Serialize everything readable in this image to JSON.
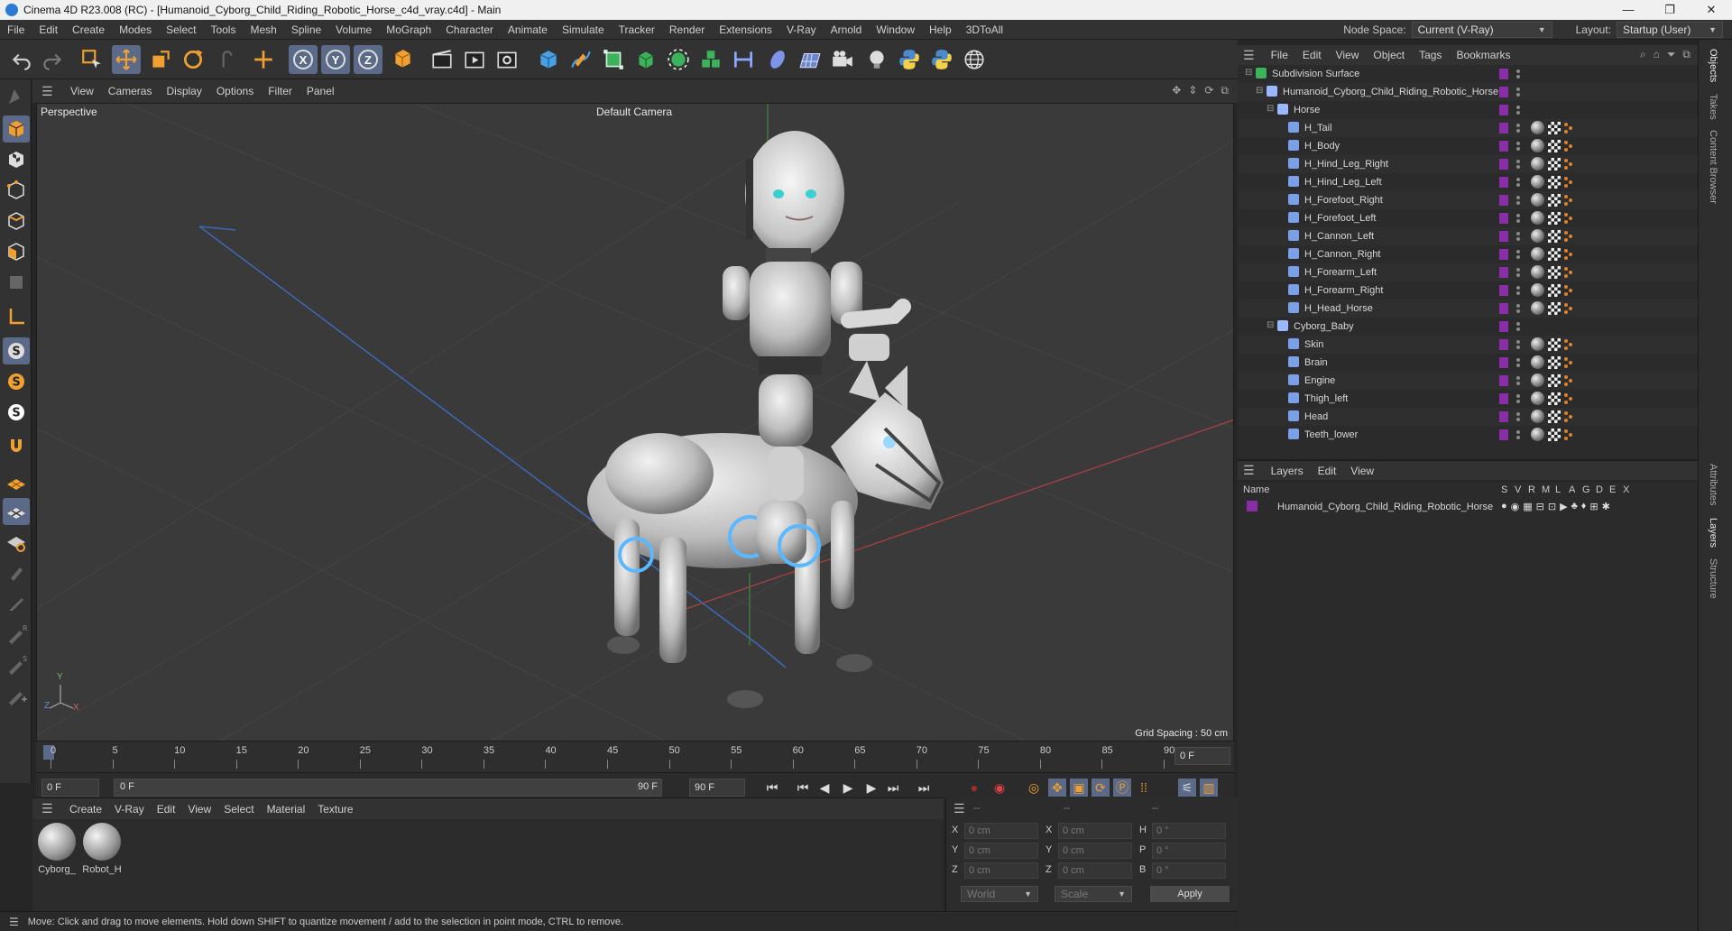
{
  "window": {
    "title": "Cinema 4D R23.008 (RC) - [Humanoid_Cyborg_Child_Riding_Robotic_Horse_c4d_vray.c4d] - Main",
    "controls": [
      "—",
      "❐",
      "✕"
    ]
  },
  "menubar": {
    "items": [
      "File",
      "Edit",
      "Create",
      "Modes",
      "Select",
      "Tools",
      "Mesh",
      "Spline",
      "Volume",
      "MoGraph",
      "Character",
      "Animate",
      "Simulate",
      "Tracker",
      "Render",
      "Extensions",
      "V-Ray",
      "Arnold",
      "Window",
      "Help",
      "3DToAll"
    ],
    "node_space_label": "Node Space:",
    "node_space_value": "Current (V-Ray)",
    "layout_label": "Layout:",
    "layout_value": "Startup (User)"
  },
  "toolbar": {
    "axis_labels": [
      "X",
      "Y",
      "Z"
    ]
  },
  "viewport": {
    "menu": [
      "View",
      "Cameras",
      "Display",
      "Options",
      "Filter",
      "Panel"
    ],
    "view_name": "Perspective",
    "camera": "Default Camera",
    "grid_spacing": "Grid Spacing : 50 cm",
    "axis_x": "X",
    "axis_y": "Y",
    "axis_z": "Z"
  },
  "timeline": {
    "ticks": [
      "0",
      "5",
      "10",
      "15",
      "20",
      "25",
      "30",
      "35",
      "40",
      "45",
      "50",
      "55",
      "60",
      "65",
      "70",
      "75",
      "80",
      "85",
      "90"
    ],
    "current_frame": "0 F",
    "start_field": "0 F",
    "range_start": "0 F",
    "range_end": "90 F",
    "end_field": "90 F"
  },
  "materials": {
    "menu": [
      "Create",
      "V-Ray",
      "Edit",
      "View",
      "Select",
      "Material",
      "Texture"
    ],
    "items": [
      "Cyborg_",
      "Robot_H"
    ]
  },
  "coords": {
    "headers": [
      "--",
      "--",
      "--"
    ],
    "rows": [
      {
        "a": "X",
        "av": "0 cm",
        "b": "X",
        "bv": "0 cm",
        "c": "H",
        "cv": "0 °"
      },
      {
        "a": "Y",
        "av": "0 cm",
        "b": "Y",
        "bv": "0 cm",
        "c": "P",
        "cv": "0 °"
      },
      {
        "a": "Z",
        "av": "0 cm",
        "b": "Z",
        "bv": "0 cm",
        "c": "B",
        "cv": "0 °"
      }
    ],
    "world": "World",
    "scale": "Scale",
    "apply": "Apply"
  },
  "status": "Move: Click and drag to move elements. Hold down SHIFT to quantize movement / add to the selection in point mode, CTRL to remove.",
  "objects": {
    "menu": [
      "File",
      "Edit",
      "View",
      "Object",
      "Tags",
      "Bookmarks"
    ],
    "rows": [
      {
        "name": "Subdivision Surface",
        "level": 0,
        "type": "subdiv"
      },
      {
        "name": "Humanoid_Cyborg_Child_Riding_Robotic_Horse",
        "level": 1,
        "type": "null"
      },
      {
        "name": "Horse",
        "level": 2,
        "type": "null"
      },
      {
        "name": "H_Tail",
        "level": 3,
        "type": "bone"
      },
      {
        "name": "H_Body",
        "level": 3,
        "type": "bone"
      },
      {
        "name": "H_Hind_Leg_Right",
        "level": 3,
        "type": "bone"
      },
      {
        "name": "H_Hind_Leg_Left",
        "level": 3,
        "type": "bone"
      },
      {
        "name": "H_Forefoot_Right",
        "level": 3,
        "type": "bone"
      },
      {
        "name": "H_Forefoot_Left",
        "level": 3,
        "type": "bone"
      },
      {
        "name": "H_Cannon_Left",
        "level": 3,
        "type": "bone"
      },
      {
        "name": "H_Cannon_Right",
        "level": 3,
        "type": "bone"
      },
      {
        "name": "H_Forearm_Left",
        "level": 3,
        "type": "bone"
      },
      {
        "name": "H_Forearm_Right",
        "level": 3,
        "type": "bone"
      },
      {
        "name": "H_Head_Horse",
        "level": 3,
        "type": "bone"
      },
      {
        "name": "Cyborg_Baby",
        "level": 2,
        "type": "null"
      },
      {
        "name": "Skin",
        "level": 3,
        "type": "bone"
      },
      {
        "name": "Brain",
        "level": 3,
        "type": "bone"
      },
      {
        "name": "Engine",
        "level": 3,
        "type": "bone"
      },
      {
        "name": "Thigh_left",
        "level": 3,
        "type": "bone"
      },
      {
        "name": "Head",
        "level": 3,
        "type": "bone"
      },
      {
        "name": "Teeth_lower",
        "level": 3,
        "type": "bone"
      }
    ]
  },
  "layers": {
    "menu": [
      "Layers",
      "Edit",
      "View"
    ],
    "name_header": "Name",
    "flags": [
      "S",
      "V",
      "R",
      "M",
      "L",
      "A",
      "G",
      "D",
      "E",
      "X"
    ],
    "rows": [
      {
        "name": "Humanoid_Cyborg_Child_Riding_Robotic_Horse"
      }
    ]
  },
  "side_tabs": [
    "Objects",
    "Takes",
    "Content Browser",
    "Attributes",
    "Layers",
    "Structure"
  ],
  "colors": {
    "accent_selected": "#5a6a88",
    "layer_color": "#8a2ea8",
    "tag_orange": "#e0832c"
  }
}
